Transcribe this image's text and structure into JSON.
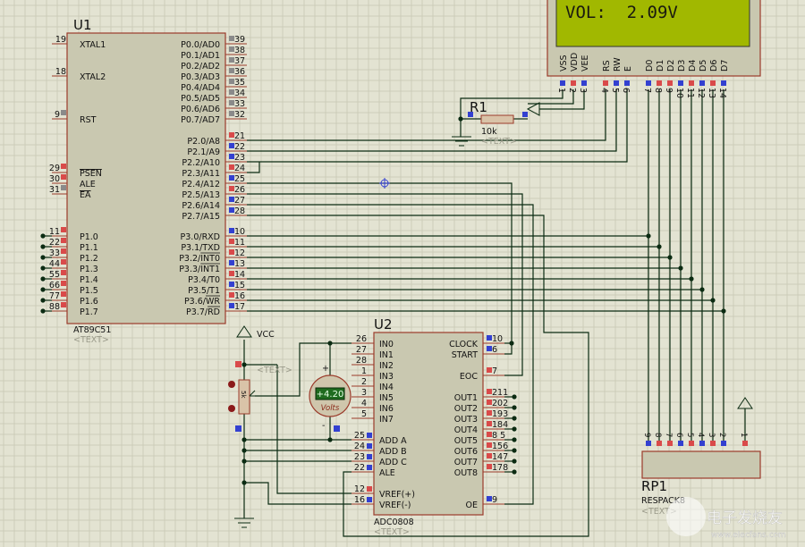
{
  "colors": {
    "background": "#e3e3d2",
    "grid": "#cdcdb9",
    "component_fill": "#c9c8b0",
    "component_border": "#9b3b2b",
    "wire": "#0b2b12",
    "pin_high": "#d94a4a",
    "pin_low": "#3340d0",
    "pin_float": "#8a8a8a",
    "lcd_screen": "#a1b800",
    "meter_display": "#1f6b1f"
  },
  "u1": {
    "ref": "U1",
    "part": "AT89C51",
    "text": "<TEXT>",
    "left_pins": [
      {
        "num": "19",
        "label": "XTAL1",
        "state": "none"
      },
      {
        "num": "18",
        "label": "XTAL2",
        "state": "none"
      },
      {
        "num": "9",
        "label": "RST",
        "state": "float"
      },
      {
        "num": "29",
        "label": "PSEN",
        "state": "high",
        "overline": true
      },
      {
        "num": "30",
        "label": "ALE",
        "state": "high"
      },
      {
        "num": "31",
        "label": "EA",
        "state": "float",
        "overline": true
      },
      {
        "num": "11",
        "label": "P1.0",
        "state": "high"
      },
      {
        "num": "22",
        "label": "P1.1",
        "state": "high"
      },
      {
        "num": "33",
        "label": "P1.2",
        "state": "high"
      },
      {
        "num": "44",
        "label": "P1.3",
        "state": "high"
      },
      {
        "num": "55",
        "label": "P1.4",
        "state": "high"
      },
      {
        "num": "66",
        "label": "P1.5",
        "state": "high"
      },
      {
        "num": "77",
        "label": "P1.6",
        "state": "high"
      },
      {
        "num": "88",
        "label": "P1.7",
        "state": "high"
      }
    ],
    "right_pins": [
      {
        "num": "39",
        "label": "P0.0/AD0",
        "state": "float"
      },
      {
        "num": "38",
        "label": "P0.1/AD1",
        "state": "float"
      },
      {
        "num": "37",
        "label": "P0.2/AD2",
        "state": "float"
      },
      {
        "num": "36",
        "label": "P0.3/AD3",
        "state": "float"
      },
      {
        "num": "35",
        "label": "P0.4/AD4",
        "state": "float"
      },
      {
        "num": "34",
        "label": "P0.5/AD5",
        "state": "float"
      },
      {
        "num": "33",
        "label": "P0.6/AD6",
        "state": "float"
      },
      {
        "num": "32",
        "label": "P0.7/AD7",
        "state": "float"
      },
      {
        "num": "21",
        "label": "P2.0/A8",
        "state": "high"
      },
      {
        "num": "22",
        "label": "P2.1/A9",
        "state": "low"
      },
      {
        "num": "23",
        "label": "P2.2/A10",
        "state": "low"
      },
      {
        "num": "24",
        "label": "P2.3/A11",
        "state": "high"
      },
      {
        "num": "25",
        "label": "P2.4/A12",
        "state": "low"
      },
      {
        "num": "26",
        "label": "P2.5/A13",
        "state": "high"
      },
      {
        "num": "27",
        "label": "P2.6/A14",
        "state": "low"
      },
      {
        "num": "28",
        "label": "P2.7/A15",
        "state": "low"
      },
      {
        "num": "10",
        "label": "P3.0/RXD",
        "state": "low"
      },
      {
        "num": "11",
        "label": "P3.1/TXD",
        "state": "high"
      },
      {
        "num": "12",
        "label": "P3.2/INT0",
        "state": "high"
      },
      {
        "num": "13",
        "label": "P3.3/INT1",
        "state": "low"
      },
      {
        "num": "14",
        "label": "P3.4/T0",
        "state": "high"
      },
      {
        "num": "15",
        "label": "P3.5/T1",
        "state": "low"
      },
      {
        "num": "16",
        "label": "P3.6/WR",
        "state": "high"
      },
      {
        "num": "17",
        "label": "P3.7/RD",
        "state": "low"
      }
    ]
  },
  "lcd": {
    "display_text": "VOL:  2.09V",
    "pins": [
      {
        "num": "1",
        "label": "VSS",
        "state": "low"
      },
      {
        "num": "2",
        "label": "VDD",
        "state": "high"
      },
      {
        "num": "3",
        "label": "VEE",
        "state": "low"
      },
      {
        "num": "4",
        "label": "RS",
        "state": "high"
      },
      {
        "num": "5",
        "label": "RW",
        "state": "low"
      },
      {
        "num": "6",
        "label": "E",
        "state": "low"
      },
      {
        "num": "7",
        "label": "D0",
        "state": "low"
      },
      {
        "num": "8",
        "label": "D1",
        "state": "high"
      },
      {
        "num": "9",
        "label": "D2",
        "state": "high"
      },
      {
        "num": "10",
        "label": "D3",
        "state": "low"
      },
      {
        "num": "11",
        "label": "D4",
        "state": "high"
      },
      {
        "num": "12",
        "label": "D5",
        "state": "low"
      },
      {
        "num": "13",
        "label": "D6",
        "state": "high"
      },
      {
        "num": "14",
        "label": "D7",
        "state": "low"
      }
    ]
  },
  "r1": {
    "ref": "R1",
    "value": "10k",
    "text": "<TEXT>"
  },
  "pot": {
    "value": "5k",
    "text": "<TEXT>",
    "vcc_label": "VCC"
  },
  "voltmeter": {
    "reading": "+4.20",
    "unit": "Volts",
    "plus": "+",
    "minus": "-"
  },
  "u2": {
    "ref": "U2",
    "part": "ADC0808",
    "text": "<TEXT>",
    "left_pins": [
      {
        "num": "26",
        "label": "IN0",
        "state": "none"
      },
      {
        "num": "27",
        "label": "IN1",
        "state": "none"
      },
      {
        "num": "28",
        "label": "IN2",
        "state": "none"
      },
      {
        "num": "1",
        "label": "IN3",
        "state": "none"
      },
      {
        "num": "2",
        "label": "IN4",
        "state": "none"
      },
      {
        "num": "3",
        "label": "IN5",
        "state": "none"
      },
      {
        "num": "4",
        "label": "IN6",
        "state": "none"
      },
      {
        "num": "5",
        "label": "IN7",
        "state": "none"
      },
      {
        "num": "25",
        "label": "ADD A",
        "state": "low"
      },
      {
        "num": "24",
        "label": "ADD B",
        "state": "low"
      },
      {
        "num": "23",
        "label": "ADD C",
        "state": "low"
      },
      {
        "num": "22",
        "label": "ALE",
        "state": "low"
      },
      {
        "num": "12",
        "label": "VREF(+)",
        "state": "high"
      },
      {
        "num": "16",
        "label": "VREF(-)",
        "state": "low"
      }
    ],
    "right_pins": [
      {
        "num": "10",
        "label": "CLOCK",
        "state": "low"
      },
      {
        "num": "6",
        "label": "START",
        "state": "low"
      },
      {
        "num": "7",
        "label": "EOC",
        "state": "high"
      },
      {
        "num": "211",
        "label": "OUT1",
        "state": "high"
      },
      {
        "num": "202",
        "label": "OUT2",
        "state": "high"
      },
      {
        "num": "193",
        "label": "OUT3",
        "state": "high"
      },
      {
        "num": "184",
        "label": "OUT4",
        "state": "high"
      },
      {
        "num": "8  5",
        "label": "OUT5",
        "state": "high"
      },
      {
        "num": "156",
        "label": "OUT6",
        "state": "high"
      },
      {
        "num": "147",
        "label": "OUT7",
        "state": "high"
      },
      {
        "num": "178",
        "label": "OUT8",
        "state": "high"
      },
      {
        "num": "9",
        "label": "OE",
        "state": "low"
      }
    ]
  },
  "rp1": {
    "ref": "RP1",
    "part": "RESPACK8",
    "text": "<TEXT>",
    "pins": [
      {
        "num": "9",
        "state": "low"
      },
      {
        "num": "8",
        "state": "high"
      },
      {
        "num": "7",
        "state": "high"
      },
      {
        "num": "6",
        "state": "low"
      },
      {
        "num": "5",
        "state": "high"
      },
      {
        "num": "4",
        "state": "low"
      },
      {
        "num": "3",
        "state": "high"
      },
      {
        "num": "2",
        "state": "low"
      },
      {
        "num": "1",
        "state": "high"
      }
    ]
  },
  "watermark": {
    "logo_text": "电子发烧友",
    "url_text": "www.elecfans.com"
  }
}
